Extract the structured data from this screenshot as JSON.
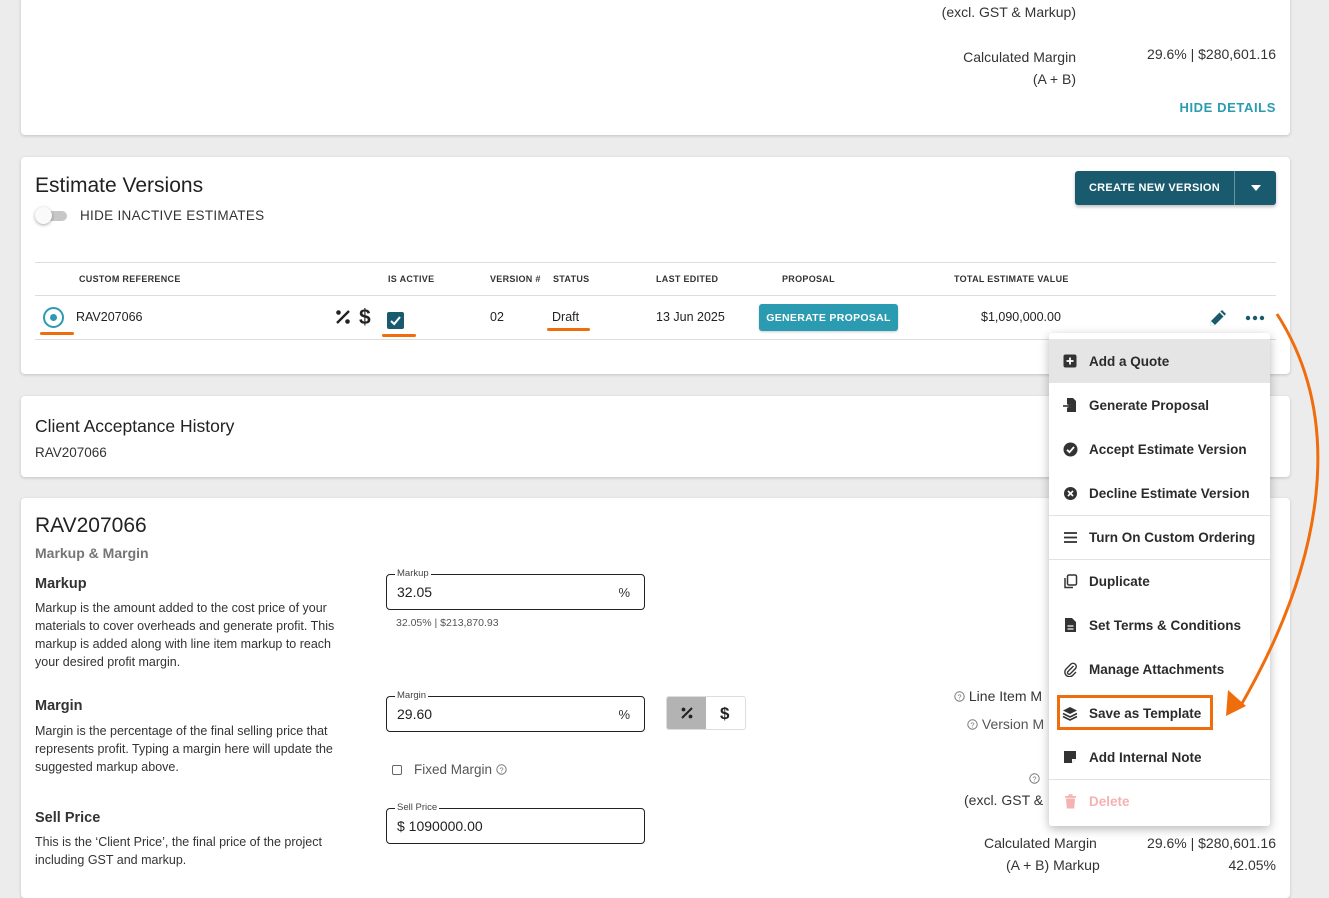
{
  "summary": {
    "excl_label": "(excl. GST & Markup)",
    "calc_margin_label_1": "Calculated Margin",
    "calc_margin_label_2": "(A + B)",
    "calc_margin_value": "29.6% | $280,601.16",
    "hide_details": "HIDE DETAILS"
  },
  "versions": {
    "title": "Estimate Versions",
    "toggle_label": "HIDE INACTIVE ESTIMATES",
    "create_button": "CREATE NEW VERSION",
    "columns": {
      "custom_reference": "CUSTOM REFERENCE",
      "is_active": "IS ACTIVE",
      "version": "VERSION #",
      "status": "STATUS",
      "last_edited": "LAST EDITED",
      "proposal": "PROPOSAL",
      "total": "TOTAL ESTIMATE VALUE"
    },
    "row": {
      "reference": "RAV207066",
      "version": "02",
      "status": "Draft",
      "last_edited": "13 Jun 2025",
      "proposal_button": "GENERATE PROPOSAL",
      "total": "$1,090,000.00"
    }
  },
  "client_history": {
    "title": "Client Acceptance History",
    "reference": "RAV207066"
  },
  "detail": {
    "title": "RAV207066",
    "subtitle": "Markup & Margin",
    "markup": {
      "heading": "Markup",
      "description": "Markup is the amount added to the cost price of your materials to cover overheads and generate profit. This markup is added along with line item markup to reach your desired profit margin.",
      "field_label": "Markup",
      "value": "32.05",
      "suffix": "%",
      "helper": "32.05% | $213,870.93"
    },
    "margin": {
      "heading": "Margin",
      "description": "Margin is the percentage of the final selling price that represents profit. Typing a margin here will update the suggested markup above.",
      "field_label": "Margin",
      "value": "29.60",
      "suffix": "%",
      "fixed_margin": "Fixed Margin"
    },
    "sell_price": {
      "heading": "Sell Price",
      "description": "This is the ‘Client Price’, the final price of the project including GST and markup.",
      "field_label": "Sell Price",
      "value": "$ 1090000.00"
    },
    "right": {
      "line_item": "Line Item M",
      "version_m": "Version M",
      "excl_partial": "(excl. GST &",
      "calc_margin": "Calculated Margin",
      "calc_margin_value": "29.6% | $280,601.16",
      "ab_markup": "(A + B) Markup",
      "ab_markup_value": "42.05%"
    }
  },
  "menu": {
    "items": [
      {
        "label": "Add a Quote",
        "icon": "plus-square-icon"
      },
      {
        "label": "Generate Proposal",
        "icon": "file-import-icon"
      },
      {
        "label": "Accept Estimate Version",
        "icon": "check-circle-icon"
      },
      {
        "label": "Decline Estimate Version",
        "icon": "x-circle-icon"
      },
      {
        "label": "Turn On Custom Ordering",
        "icon": "list-icon"
      },
      {
        "label": "Duplicate",
        "icon": "copy-icon"
      },
      {
        "label": "Set Terms & Conditions",
        "icon": "document-icon"
      },
      {
        "label": "Manage Attachments",
        "icon": "paperclip-icon"
      },
      {
        "label": "Save as Template",
        "icon": "layers-icon"
      },
      {
        "label": "Add Internal Note",
        "icon": "note-icon"
      },
      {
        "label": "Delete",
        "icon": "trash-icon"
      }
    ]
  },
  "colors": {
    "primary": "#1a5a6e",
    "accent": "#2a9bb0",
    "annotation": "#f06d0e"
  }
}
